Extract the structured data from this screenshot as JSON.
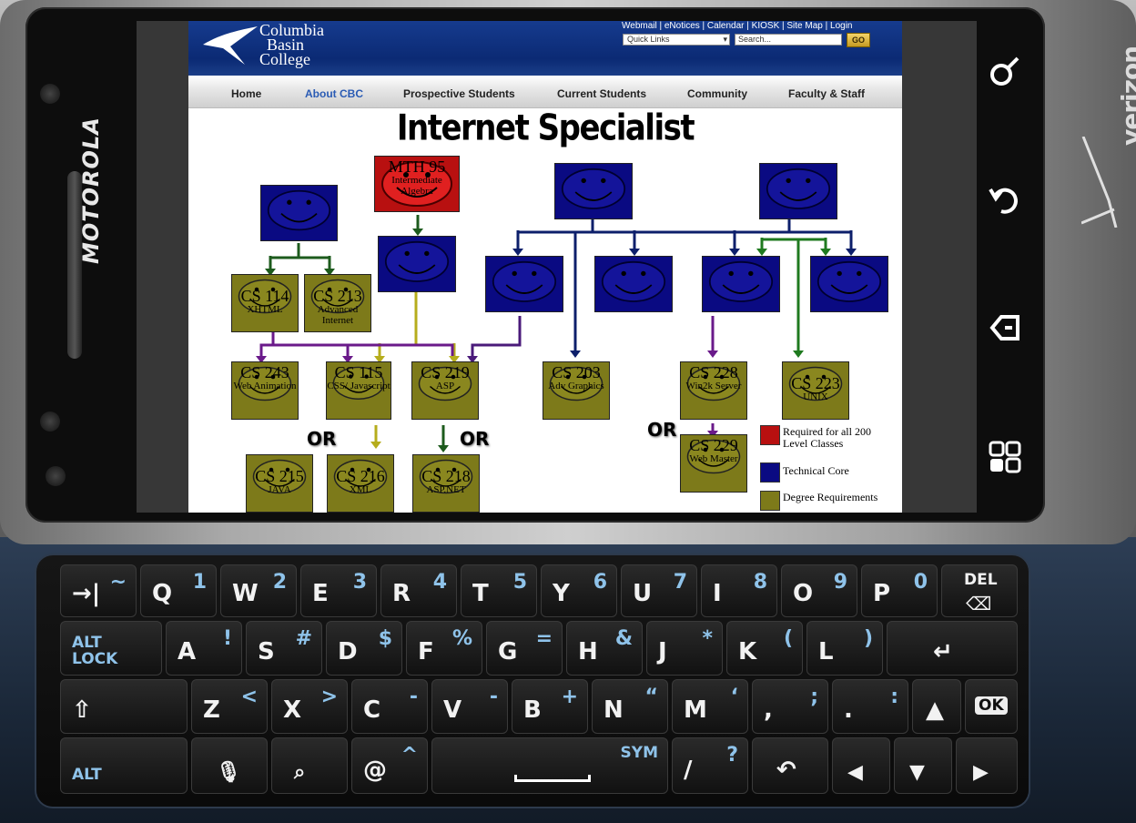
{
  "device": {
    "brand": "MOTOROLA",
    "carrier": "verizon"
  },
  "nav_keys": {
    "search": "search-key",
    "back": "back-key",
    "menu": "menu-key",
    "home": "home-key"
  },
  "website": {
    "logo": {
      "line1": "Columbia",
      "line2": "Basin",
      "line3": "College"
    },
    "utility_links": "Webmail | eNotices | Calendar | KIOSK | Site Map | Login",
    "quick_links": "Quick Links",
    "search_placeholder": "Search...",
    "go": "GO",
    "nav": [
      "Home",
      "About CBC",
      "Prospective Students",
      "Current Students",
      "Community",
      "Faculty & Staff"
    ],
    "title": "Internet Specialist"
  },
  "diagram": {
    "nodes": {
      "mth95": {
        "code": "MTH 95",
        "sub": "Intermediate Algebra"
      },
      "cs114": {
        "code": "CS 114",
        "sub": "XHTML"
      },
      "cs213": {
        "code": "CS 213",
        "sub": "Advanced Internet"
      },
      "cs243": {
        "code": "CS 243",
        "sub": "Web Animation"
      },
      "cs115": {
        "code": "CS 115",
        "sub": "CSS/ Javascript"
      },
      "cs219": {
        "code": "CS 219",
        "sub": "ASP"
      },
      "cs203": {
        "code": "CS 203",
        "sub": "Adv Graphics"
      },
      "cs228": {
        "code": "CS 228",
        "sub": "Win2k Server"
      },
      "cs223": {
        "code": "CS 223",
        "sub": "UNIX"
      },
      "cs215": {
        "code": "CS 215",
        "sub": "JAVA"
      },
      "cs216": {
        "code": "CS 216",
        "sub": "XML"
      },
      "cs218": {
        "code": "CS 218",
        "sub": "ASP.NET"
      },
      "cs229": {
        "code": "CS 229",
        "sub": "Web Master"
      }
    },
    "or_labels": [
      "OR",
      "OR",
      "OR"
    ],
    "legend": {
      "red": "Required for all 200 Level Classes",
      "blue": "Technical Core",
      "olive": "Degree Requirements"
    }
  },
  "keyboard": {
    "row1": [
      {
        "main": "→|",
        "alt": "~"
      },
      {
        "main": "Q",
        "alt": "1"
      },
      {
        "main": "W",
        "alt": "2"
      },
      {
        "main": "E",
        "alt": "3"
      },
      {
        "main": "R",
        "alt": "4"
      },
      {
        "main": "T",
        "alt": "5"
      },
      {
        "main": "Y",
        "alt": "6"
      },
      {
        "main": "U",
        "alt": "7"
      },
      {
        "main": "I",
        "alt": "8"
      },
      {
        "main": "O",
        "alt": "9"
      },
      {
        "main": "P",
        "alt": "0"
      },
      {
        "main": "DEL",
        "alt": ""
      }
    ],
    "row2": [
      {
        "main": "ALT LOCK",
        "alt": ""
      },
      {
        "main": "A",
        "alt": "!"
      },
      {
        "main": "S",
        "alt": "#"
      },
      {
        "main": "D",
        "alt": "$"
      },
      {
        "main": "F",
        "alt": "%"
      },
      {
        "main": "G",
        "alt": "="
      },
      {
        "main": "H",
        "alt": "&"
      },
      {
        "main": "J",
        "alt": "*"
      },
      {
        "main": "K",
        "alt": "("
      },
      {
        "main": "L",
        "alt": ")"
      },
      {
        "main": "↵",
        "alt": ""
      }
    ],
    "row3": [
      {
        "main": "⇧",
        "alt": ""
      },
      {
        "main": "Z",
        "alt": "<"
      },
      {
        "main": "X",
        "alt": ">"
      },
      {
        "main": "C",
        "alt": "-"
      },
      {
        "main": "V",
        "alt": "-"
      },
      {
        "main": "B",
        "alt": "+"
      },
      {
        "main": "N",
        "alt": "“"
      },
      {
        "main": "M",
        "alt": "‘"
      },
      {
        "main": ",",
        "alt": ";"
      },
      {
        "main": ".",
        "alt": ":"
      },
      {
        "main": "▲",
        "alt": ""
      },
      {
        "main": "OK",
        "alt": ""
      }
    ],
    "row4": [
      {
        "main": "ALT",
        "alt": ""
      },
      {
        "main": "🎤",
        "alt": ""
      },
      {
        "main": "🔍",
        "alt": ""
      },
      {
        "main": "@",
        "alt": "^"
      },
      {
        "main": "SYM",
        "alt": ""
      },
      {
        "main": "/",
        "alt": "?"
      },
      {
        "main": "↶",
        "alt": ""
      },
      {
        "main": "◀",
        "alt": ""
      },
      {
        "main": "▼",
        "alt": ""
      },
      {
        "main": "▶",
        "alt": ""
      }
    ]
  }
}
